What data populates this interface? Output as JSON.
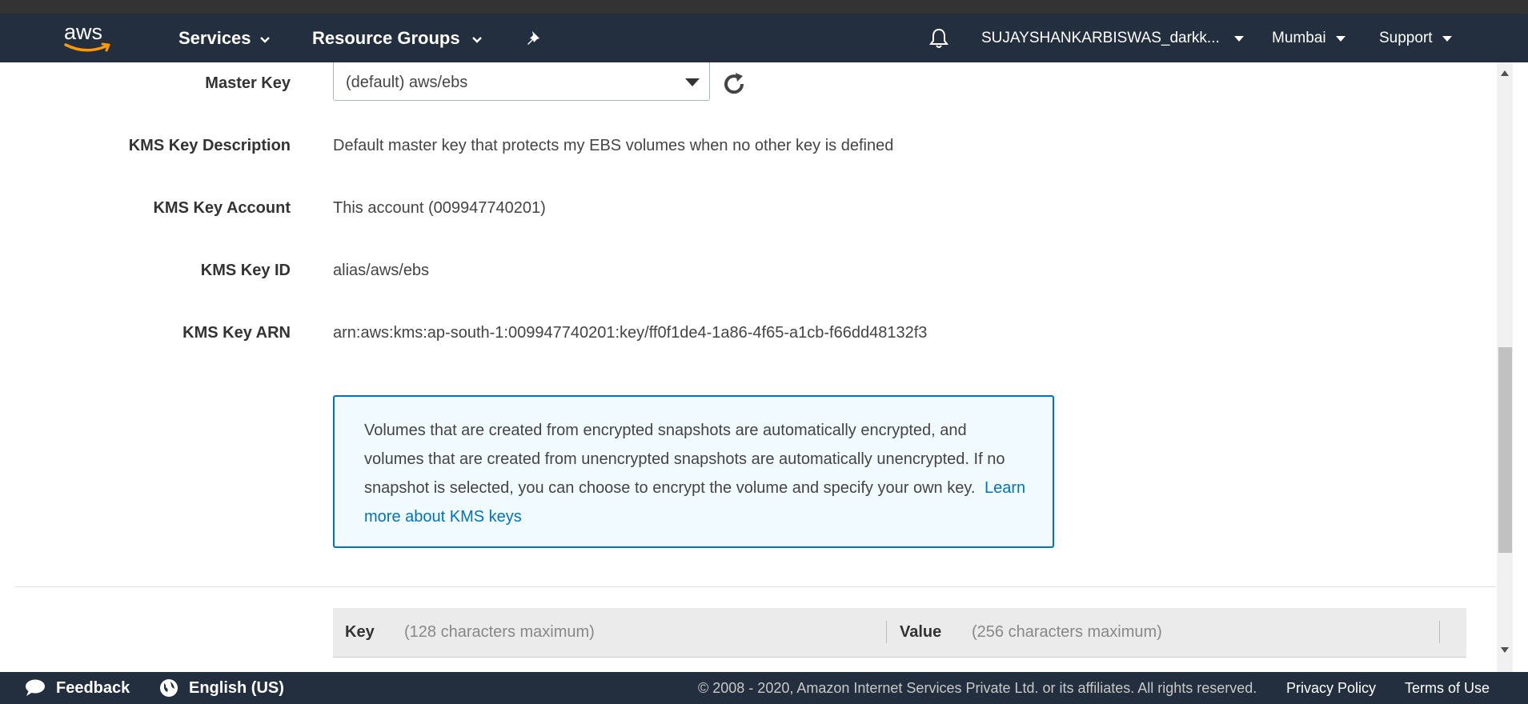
{
  "nav": {
    "logo_text": "aws",
    "services": "Services",
    "resource_groups": "Resource Groups",
    "account": "SUJAYSHANKARBISWAS_darkk...",
    "region": "Mumbai",
    "support": "Support"
  },
  "form": {
    "master_key_label": "Master Key",
    "master_key_value": "(default) aws/ebs",
    "kms_description_label": "KMS Key Description",
    "kms_description_value": "Default master key that protects my EBS volumes when no other key is defined",
    "kms_account_label": "KMS Key Account",
    "kms_account_value": "This account (009947740201)",
    "kms_id_label": "KMS Key ID",
    "kms_id_value": "alias/aws/ebs",
    "kms_arn_label": "KMS Key ARN",
    "kms_arn_value": "arn:aws:kms:ap-south-1:009947740201:key/ff0f1de4-1a86-4f65-a1cb-f66dd48132f3"
  },
  "info": {
    "text": "Volumes that are created from encrypted snapshots are automatically encrypted, and volumes that are created from unencrypted snapshots are automatically unencrypted. If no snapshot is selected, you can choose to encrypt the volume and specify your own key.",
    "link": "Learn more about KMS keys"
  },
  "tags": {
    "key_label": "Key",
    "key_hint": "(128 characters maximum)",
    "value_label": "Value",
    "value_hint": "(256 characters maximum)"
  },
  "footer": {
    "feedback": "Feedback",
    "language": "English (US)",
    "copyright": "© 2008 - 2020, Amazon Internet Services Private Ltd. or its affiliates. All rights reserved.",
    "privacy": "Privacy Policy",
    "terms": "Terms of Use"
  },
  "colors": {
    "nav_bg": "#232f3e",
    "link": "#0073bb",
    "info_bg": "#f1faff",
    "aws_orange": "#ff9900"
  },
  "icons": [
    "aws-logo",
    "chevron-down-icon",
    "pin-icon",
    "bell-icon",
    "refresh-icon",
    "speech-bubble-icon",
    "globe-icon"
  ]
}
